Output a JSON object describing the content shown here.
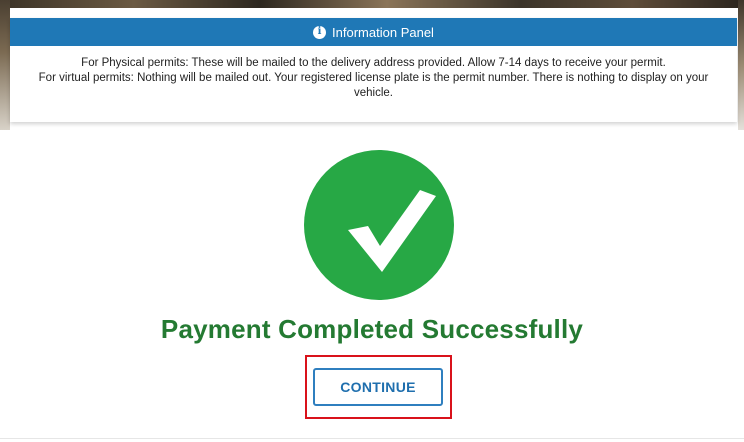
{
  "info_panel": {
    "title": "Information Panel",
    "icon": "info-icon",
    "line1": "For Physical permits: These will be mailed to the delivery address provided. Allow 7-14 days to receive your permit.",
    "line2": "For virtual permits: Nothing will be mailed out. Your registered license plate is the permit number. There is nothing to display on your vehicle."
  },
  "success": {
    "icon": "checkmark-icon",
    "title": "Payment Completed Successfully"
  },
  "actions": {
    "continue_label": "CONTINUE"
  },
  "colors": {
    "header_blue": "#1f78b6",
    "success_green": "#27a845",
    "title_green": "#247a32",
    "button_blue": "#2f7fbf",
    "highlight_red": "#d9121b"
  }
}
